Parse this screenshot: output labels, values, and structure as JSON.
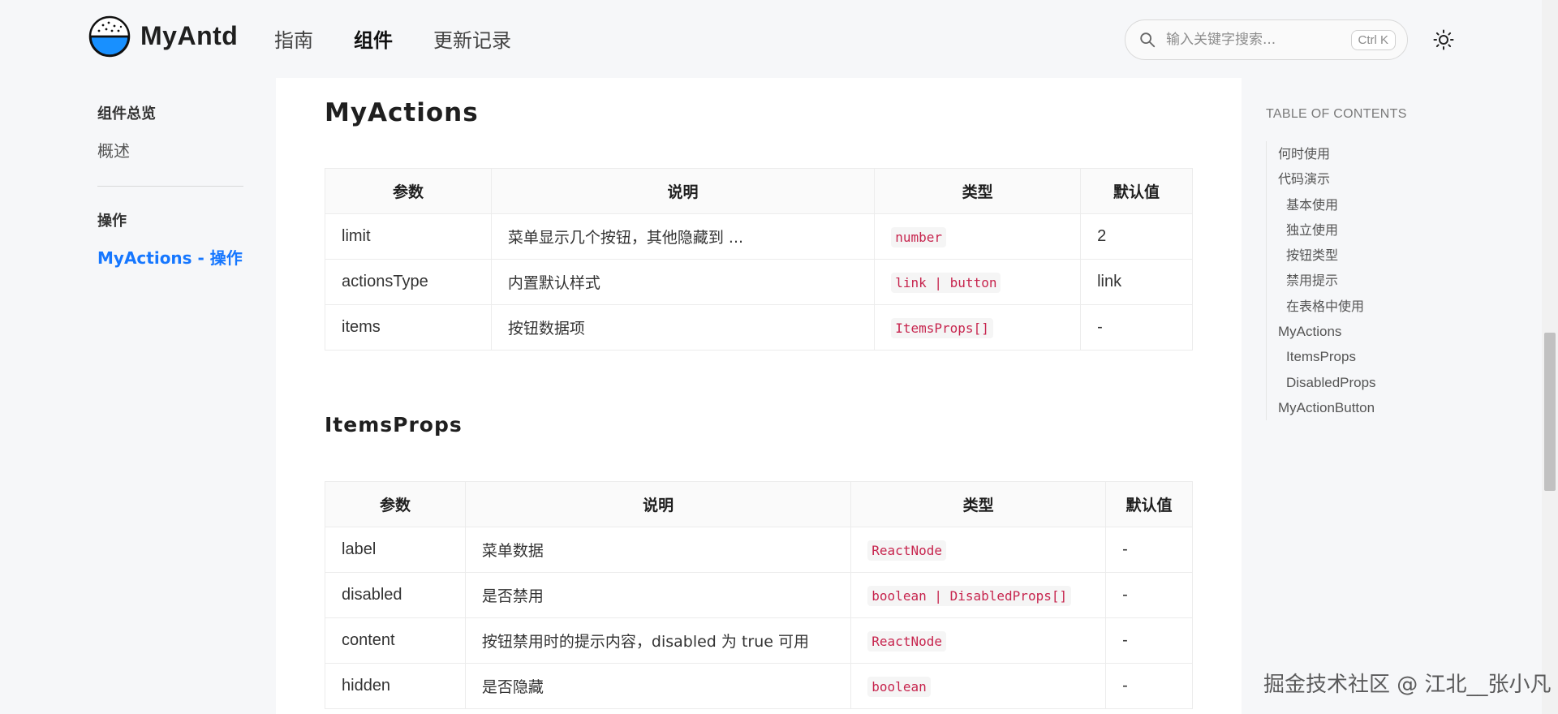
{
  "header": {
    "brand": "MyAntd",
    "nav": [
      "指南",
      "组件",
      "更新记录"
    ],
    "search_placeholder": "输入关键字搜索...",
    "search_shortcut": "Ctrl K"
  },
  "sidebar": {
    "group1": "组件总览",
    "item1": "概述",
    "group2": "操作",
    "item2": "MyActions - 操作"
  },
  "main": {
    "section1_title": "MyActions",
    "table1": {
      "headers": [
        "参数",
        "说明",
        "类型",
        "默认值"
      ],
      "rows": [
        {
          "param": "limit",
          "desc": "菜单显示几个按钮，其他隐藏到 ...",
          "type": "number",
          "default": "2"
        },
        {
          "param": "actionsType",
          "desc": "内置默认样式",
          "type": "link | button",
          "default": "link"
        },
        {
          "param": "items",
          "desc": "按钮数据项",
          "type": "ItemsProps[]",
          "default": "-"
        }
      ]
    },
    "section2_title": "ItemsProps",
    "table2": {
      "headers": [
        "参数",
        "说明",
        "类型",
        "默认值"
      ],
      "rows": [
        {
          "param": "label",
          "desc": "菜单数据",
          "type": "ReactNode",
          "default": "-"
        },
        {
          "param": "disabled",
          "desc": "是否禁用",
          "type": "boolean | DisabledProps[]",
          "default": "-"
        },
        {
          "param": "content",
          "desc": "按钮禁用时的提示内容，disabled 为 true 可用",
          "type": "ReactNode",
          "default": "-"
        },
        {
          "param": "hidden",
          "desc": "是否隐藏",
          "type": "boolean",
          "default": "-"
        }
      ]
    }
  },
  "toc": {
    "title": "TABLE OF CONTENTS",
    "items": [
      "何时使用",
      "代码演示",
      "基本使用",
      "独立使用",
      "按钮类型",
      "禁用提示",
      "在表格中使用",
      "MyActions",
      "ItemsProps",
      "DisabledProps",
      "MyActionButton"
    ]
  },
  "watermark": "掘金技术社区 @ 江北__张小凡",
  "colors": {
    "accent": "#1677ff",
    "code": "#c7254e"
  }
}
